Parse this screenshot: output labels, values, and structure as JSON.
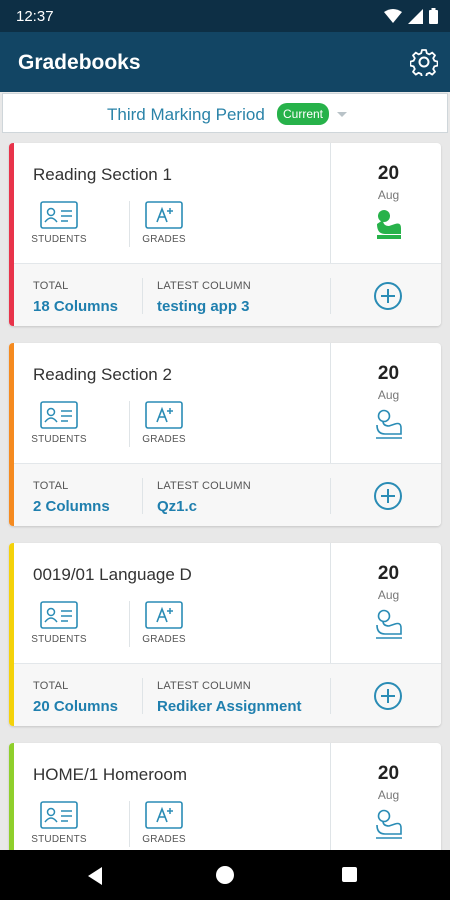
{
  "status_bar": {
    "time": "12:37",
    "icons": [
      "wifi-icon",
      "signal-icon",
      "battery-icon"
    ]
  },
  "app_bar": {
    "title": "Gradebooks",
    "icon": "gear-icon"
  },
  "period": {
    "label": "Third Marking Period",
    "badge": "Current",
    "icon": "chevron-down-icon"
  },
  "cards": [
    {
      "name": "Reading Section 1",
      "students_label": "STUDENTS",
      "grades_label": "GRADES",
      "day": "20",
      "month": "Aug",
      "total_label": "TOTAL",
      "total_value": "18 Columns",
      "latest_label": "LATEST COLUMN",
      "latest_value": "testing app 3",
      "stripe_color": "#e8334a",
      "seat_active": true
    },
    {
      "name": "Reading Section 2",
      "students_label": "STUDENTS",
      "grades_label": "GRADES",
      "day": "20",
      "month": "Aug",
      "total_label": "TOTAL",
      "total_value": "2 Columns",
      "latest_label": "LATEST COLUMN",
      "latest_value": "Qz1.c",
      "stripe_color": "#f58a1f",
      "seat_active": false
    },
    {
      "name": "0019/01 Language D",
      "students_label": "STUDENTS",
      "grades_label": "GRADES",
      "day": "20",
      "month": "Aug",
      "total_label": "TOTAL",
      "total_value": "20 Columns",
      "latest_label": "LATEST COLUMN",
      "latest_value": "Rediker Assignment",
      "stripe_color": "#f4d20a",
      "seat_active": false
    },
    {
      "name": "HOME/1 Homeroom",
      "students_label": "STUDENTS",
      "grades_label": "GRADES",
      "day": "20",
      "month": "Aug",
      "stripe_color": "#8fcf2b",
      "seat_active": false
    }
  ],
  "nav_bar": {
    "icons": [
      "back-icon",
      "home-icon",
      "recents-icon"
    ]
  }
}
